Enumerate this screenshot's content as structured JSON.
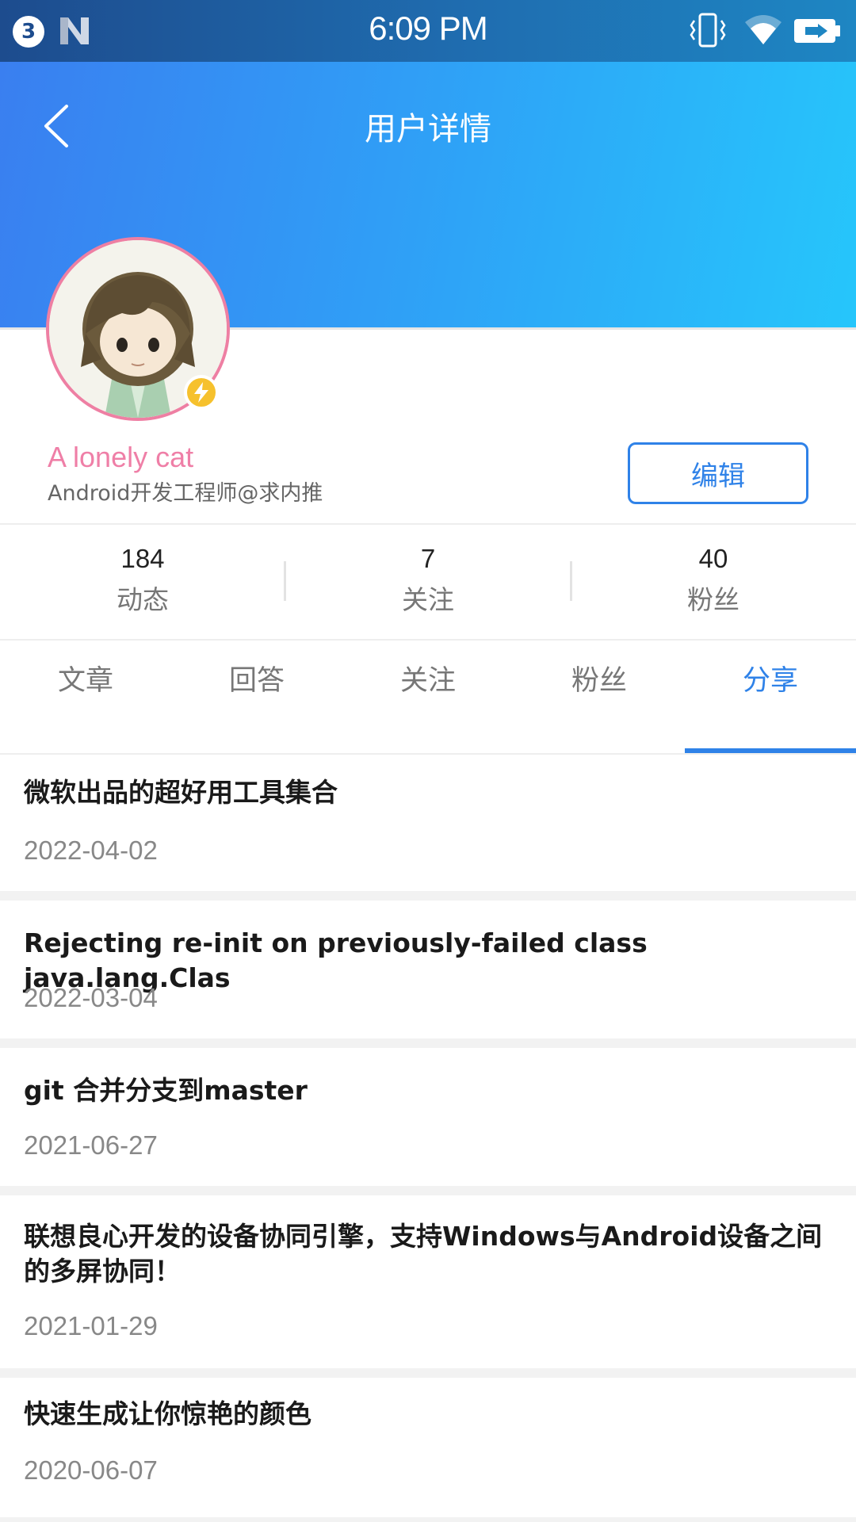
{
  "status_bar": {
    "badge": "3",
    "time": "6:09 PM"
  },
  "header": {
    "title": "用户详情",
    "gradient_start": "#3a7ef0",
    "gradient_end": "#26c6fb"
  },
  "profile": {
    "name": "A lonely cat",
    "subtitle": "Android开发工程师@求内推",
    "edit_label": "编辑",
    "name_color": "#ef7fa7"
  },
  "stats": [
    {
      "value": "184",
      "label": "动态"
    },
    {
      "value": "7",
      "label": "关注"
    },
    {
      "value": "40",
      "label": "粉丝"
    }
  ],
  "tabs": [
    {
      "label": "文章",
      "active": false
    },
    {
      "label": "回答",
      "active": false
    },
    {
      "label": "关注",
      "active": false
    },
    {
      "label": "粉丝",
      "active": false
    },
    {
      "label": "分享",
      "active": true
    }
  ],
  "articles": [
    {
      "title": "微软出品的超好用工具集合",
      "date": "2022-04-02"
    },
    {
      "title": "Rejecting re-init on previously-failed class java.lang.Clas",
      "date": "2022-03-04"
    },
    {
      "title": "git 合并分支到master",
      "date": "2021-06-27"
    },
    {
      "title": "联想良心开发的设备协同引擎，支持Windows与Android设备之间的多屏协同！",
      "date": "2021-01-29"
    },
    {
      "title": "快速生成让你惊艳的颜色",
      "date": "2020-06-07"
    }
  ],
  "accent_color": "#2f82e8",
  "icons": [
    "back-arrow-icon",
    "vibrate-icon",
    "wifi-icon",
    "battery-charging-icon",
    "lightning-icon"
  ]
}
